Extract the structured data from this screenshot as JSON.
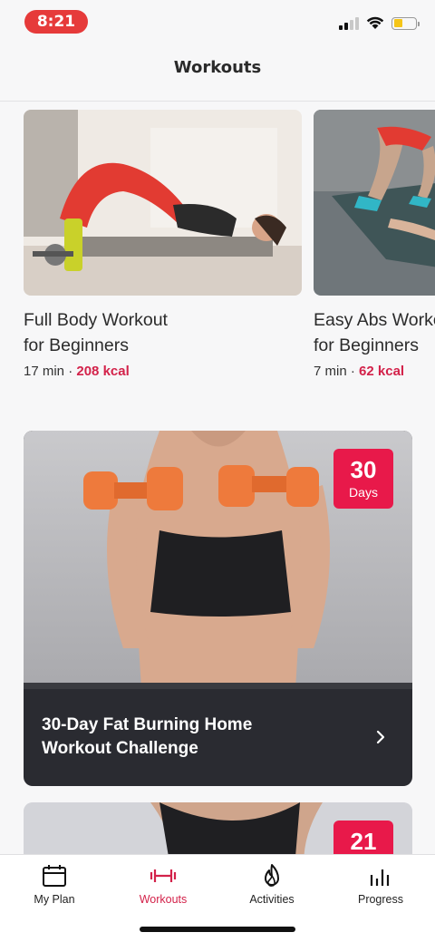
{
  "status_bar": {
    "time": "8:21",
    "icons": [
      "signal-icon",
      "wifi-icon",
      "battery-icon"
    ],
    "battery_color": "#f5c518"
  },
  "header": {
    "title": "Workouts"
  },
  "workouts": [
    {
      "title_line1": "Full Body Workout",
      "title_line2": "for Beginners",
      "duration": "17 min",
      "separator": " · ",
      "kcal": "208 kcal"
    },
    {
      "title_line1": "Easy Abs Workout",
      "title_line2": "for Beginners",
      "duration": "7 min",
      "separator": " · ",
      "kcal": "62 kcal"
    }
  ],
  "challenges": [
    {
      "days_number": "30",
      "days_label": "Days",
      "title_line1": "30-Day Fat Burning Home",
      "title_line2": "Workout Challenge"
    },
    {
      "days_number": "21"
    }
  ],
  "tabs": [
    {
      "label": "My Plan",
      "icon": "calendar-icon",
      "active": false
    },
    {
      "label": "Workouts",
      "icon": "dumbbell-icon",
      "active": true
    },
    {
      "label": "Activities",
      "icon": "flame-icon",
      "active": false
    },
    {
      "label": "Progress",
      "icon": "bar-chart-icon",
      "active": false
    }
  ],
  "colors": {
    "accent": "#d3224a",
    "badge": "#e8194a",
    "time_pill": "#e63a3a",
    "card_dark": "#2a2b31"
  }
}
